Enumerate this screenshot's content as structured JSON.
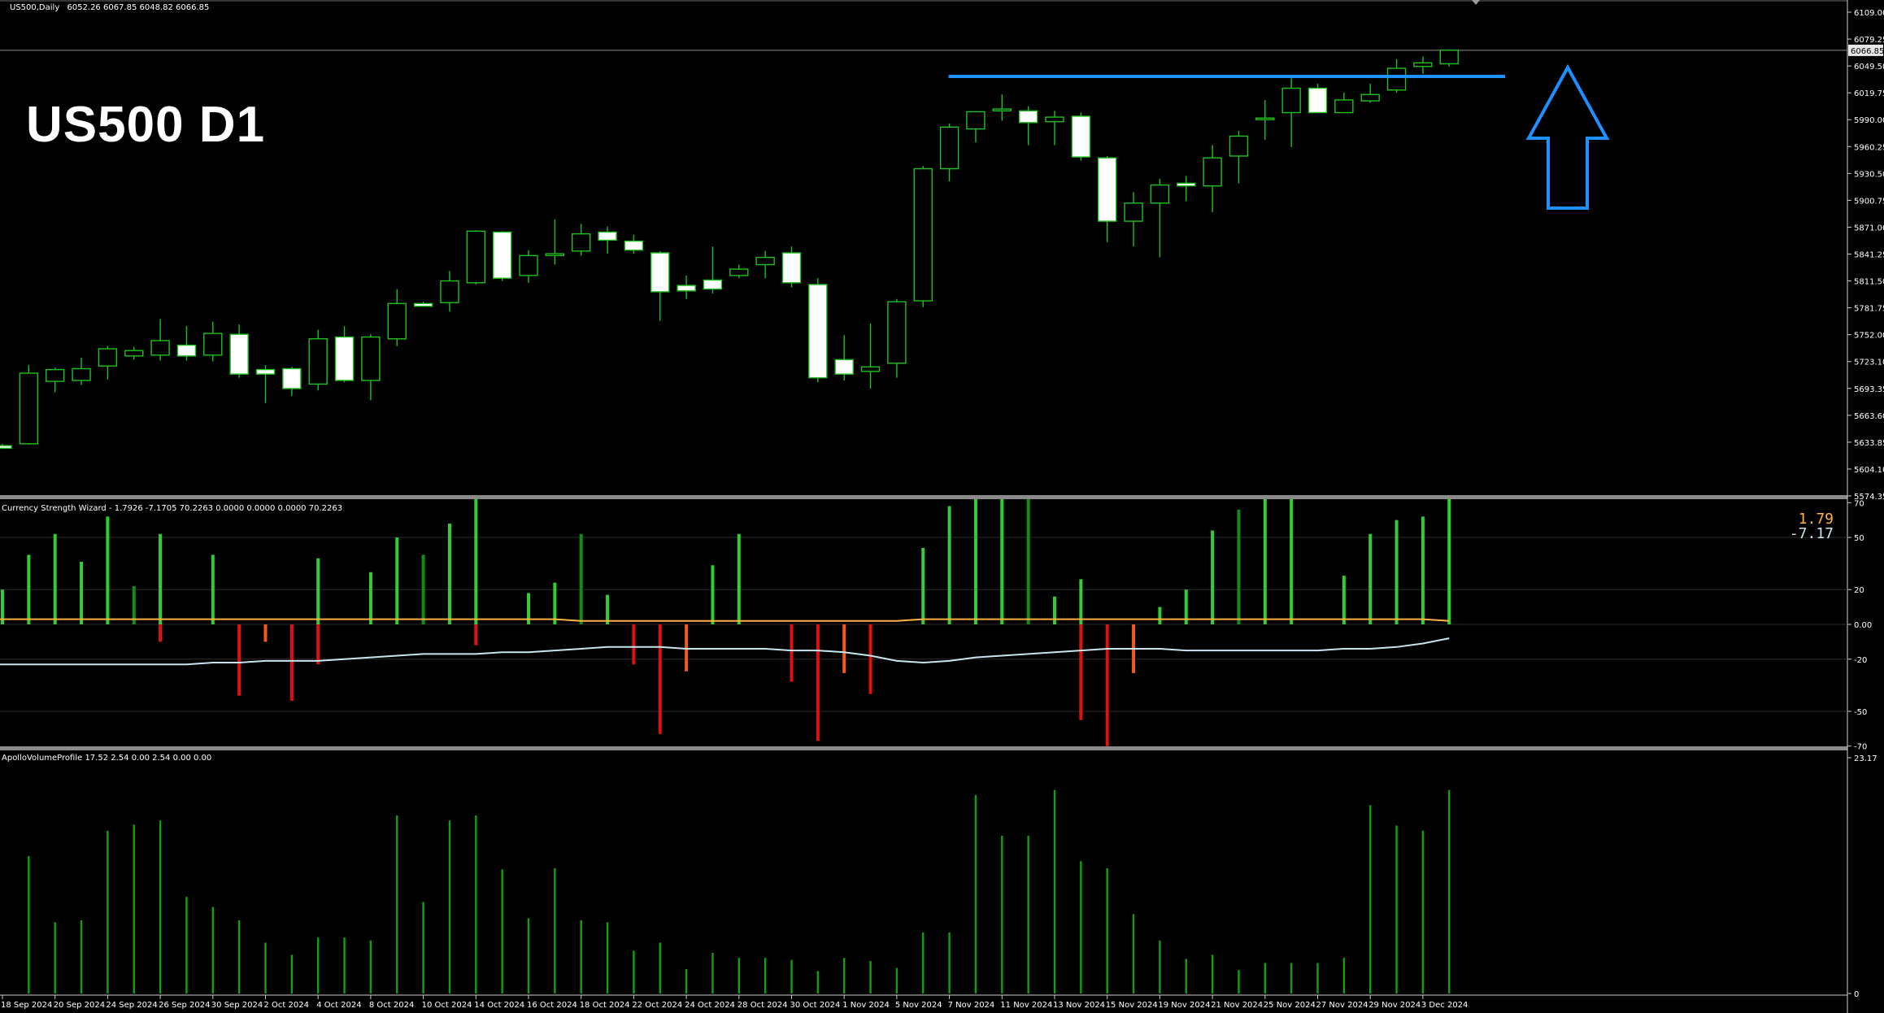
{
  "header": {
    "symbol_label": "US500,Daily",
    "ohlc": "6052.26 6067.85 6048.82 6066.85",
    "big_label": "US500 D1",
    "csw_label": "Currency Strength Wizard - 1.7926 -7.1705 70.2263 0.0000 0.0000 0.0000 70.2263",
    "avp_label": "ApolloVolumeProfile 17.52 2.54 0.00 2.54 0.00 0.00",
    "csw_value_1": "1.79",
    "csw_value_2": "-7.17"
  },
  "colors": {
    "background": "#000000",
    "grid": "#2d2d2d",
    "candle_wick": "#1fc01f",
    "candle_bull_body": "#000000",
    "candle_bear_body": "#ffffff",
    "resistance_line": "#1e90ff",
    "arrow": "#1e90ff",
    "pos_bar": "#33cc33",
    "pos_bar_dark": "#168a16",
    "neg_bar": "#e01010",
    "neg_bar_orange": "#f05a1e",
    "csw_line_1": "#ffb347",
    "csw_line_2": "#c8e6f0",
    "volume_bar": "#129f12",
    "csw_value_1": "#ffb347",
    "csw_value_2": "#c8e6f0"
  },
  "chart_data": [
    {
      "type": "candlestick",
      "name": "price",
      "ylim": [
        5574.35,
        6109.0
      ],
      "y_ticks": [
        "6109.00",
        "6079.25",
        "6049.50",
        "6019.75",
        "5990.00",
        "5960.25",
        "5930.50",
        "5900.75",
        "5871.00",
        "5841.25",
        "5811.50",
        "5781.75",
        "5752.00",
        "5723.10",
        "5693.35",
        "5663.60",
        "5633.85",
        "5604.10",
        "5574.35"
      ],
      "current_price": "6066.85",
      "current_price_value": 6066.85,
      "resistance_level": 6038.0,
      "resistance_range": [
        36,
        57
      ],
      "arrow": "up",
      "x_tick_labels": [
        {
          "i": 0,
          "label": "18 Sep 2024"
        },
        {
          "i": 2,
          "label": "20 Sep 2024"
        },
        {
          "i": 4,
          "label": "24 Sep 2024"
        },
        {
          "i": 6,
          "label": "26 Sep 2024"
        },
        {
          "i": 8,
          "label": "30 Sep 2024"
        },
        {
          "i": 10,
          "label": "2 Oct 2024"
        },
        {
          "i": 12,
          "label": "4 Oct 2024"
        },
        {
          "i": 14,
          "label": "8 Oct 2024"
        },
        {
          "i": 16,
          "label": "10 Oct 2024"
        },
        {
          "i": 18,
          "label": "14 Oct 2024"
        },
        {
          "i": 20,
          "label": "16 Oct 2024"
        },
        {
          "i": 22,
          "label": "18 Oct 2024"
        },
        {
          "i": 24,
          "label": "22 Oct 2024"
        },
        {
          "i": 26,
          "label": "24 Oct 2024"
        },
        {
          "i": 28,
          "label": "28 Oct 2024"
        },
        {
          "i": 30,
          "label": "30 Oct 2024"
        },
        {
          "i": 32,
          "label": "1 Nov 2024"
        },
        {
          "i": 34,
          "label": "5 Nov 2024"
        },
        {
          "i": 36,
          "label": "7 Nov 2024"
        },
        {
          "i": 38,
          "label": "11 Nov 2024"
        },
        {
          "i": 40,
          "label": "13 Nov 2024"
        },
        {
          "i": 42,
          "label": "15 Nov 2024"
        },
        {
          "i": 44,
          "label": "19 Nov 2024"
        },
        {
          "i": 46,
          "label": "21 Nov 2024"
        },
        {
          "i": 48,
          "label": "25 Nov 2024"
        },
        {
          "i": 50,
          "label": "27 Nov 2024"
        },
        {
          "i": 52,
          "label": "29 Nov 2024"
        },
        {
          "i": 54,
          "label": "3 Dec 2024"
        }
      ],
      "candles": [
        {
          "o": 5630,
          "h": 5632,
          "l": 5627,
          "c": 5627
        },
        {
          "o": 5632,
          "h": 5719,
          "l": 5631,
          "c": 5710
        },
        {
          "o": 5701,
          "h": 5716,
          "l": 5689,
          "c": 5714
        },
        {
          "o": 5702,
          "h": 5727,
          "l": 5697,
          "c": 5715
        },
        {
          "o": 5718,
          "h": 5740,
          "l": 5703,
          "c": 5737
        },
        {
          "o": 5729,
          "h": 5739,
          "l": 5725,
          "c": 5735
        },
        {
          "o": 5730,
          "h": 5770,
          "l": 5724,
          "c": 5746
        },
        {
          "o": 5741,
          "h": 5762,
          "l": 5724,
          "c": 5729
        },
        {
          "o": 5730,
          "h": 5767,
          "l": 5723,
          "c": 5754
        },
        {
          "o": 5753,
          "h": 5764,
          "l": 5705,
          "c": 5709
        },
        {
          "o": 5714,
          "h": 5719,
          "l": 5677,
          "c": 5709
        },
        {
          "o": 5715,
          "h": 5717,
          "l": 5685,
          "c": 5693
        },
        {
          "o": 5698,
          "h": 5758,
          "l": 5691,
          "c": 5748
        },
        {
          "o": 5750,
          "h": 5762,
          "l": 5700,
          "c": 5702
        },
        {
          "o": 5702,
          "h": 5753,
          "l": 5680,
          "c": 5750
        },
        {
          "o": 5748,
          "h": 5803,
          "l": 5740,
          "c": 5787
        },
        {
          "o": 5787,
          "h": 5789,
          "l": 5784,
          "c": 5784
        },
        {
          "o": 5788,
          "h": 5823,
          "l": 5778,
          "c": 5812
        },
        {
          "o": 5810,
          "h": 5868,
          "l": 5808,
          "c": 5867
        },
        {
          "o": 5866,
          "h": 5867,
          "l": 5812,
          "c": 5815
        },
        {
          "o": 5818,
          "h": 5846,
          "l": 5810,
          "c": 5840
        },
        {
          "o": 5840,
          "h": 5880,
          "l": 5830,
          "c": 5842
        },
        {
          "o": 5845,
          "h": 5875,
          "l": 5840,
          "c": 5864
        },
        {
          "o": 5866,
          "h": 5872,
          "l": 5842,
          "c": 5857
        },
        {
          "o": 5856,
          "h": 5863,
          "l": 5842,
          "c": 5846
        },
        {
          "o": 5843,
          "h": 5845,
          "l": 5768,
          "c": 5800
        },
        {
          "o": 5807,
          "h": 5818,
          "l": 5792,
          "c": 5801
        },
        {
          "o": 5813,
          "h": 5850,
          "l": 5798,
          "c": 5803
        },
        {
          "o": 5818,
          "h": 5830,
          "l": 5815,
          "c": 5825
        },
        {
          "o": 5830,
          "h": 5845,
          "l": 5815,
          "c": 5838
        },
        {
          "o": 5843,
          "h": 5850,
          "l": 5805,
          "c": 5810
        },
        {
          "o": 5808,
          "h": 5815,
          "l": 5700,
          "c": 5705
        },
        {
          "o": 5725,
          "h": 5752,
          "l": 5702,
          "c": 5709
        },
        {
          "o": 5712,
          "h": 5765,
          "l": 5693,
          "c": 5717
        },
        {
          "o": 5721,
          "h": 5792,
          "l": 5705,
          "c": 5789
        },
        {
          "o": 5790,
          "h": 5939,
          "l": 5783,
          "c": 5936
        },
        {
          "o": 5936,
          "h": 5986,
          "l": 5922,
          "c": 5982
        },
        {
          "o": 5980,
          "h": 5998,
          "l": 5965,
          "c": 5999
        },
        {
          "o": 6000,
          "h": 6018,
          "l": 5989,
          "c": 6002
        },
        {
          "o": 6000,
          "h": 6005,
          "l": 5962,
          "c": 5987
        },
        {
          "o": 5988,
          "h": 6000,
          "l": 5962,
          "c": 5993
        },
        {
          "o": 5994,
          "h": 5998,
          "l": 5945,
          "c": 5949
        },
        {
          "o": 5948,
          "h": 5950,
          "l": 5855,
          "c": 5878
        },
        {
          "o": 5878,
          "h": 5910,
          "l": 5850,
          "c": 5898
        },
        {
          "o": 5898,
          "h": 5925,
          "l": 5838,
          "c": 5918
        },
        {
          "o": 5920,
          "h": 5928,
          "l": 5900,
          "c": 5917
        },
        {
          "o": 5917,
          "h": 5962,
          "l": 5888,
          "c": 5948
        },
        {
          "o": 5950,
          "h": 5978,
          "l": 5920,
          "c": 5972
        },
        {
          "o": 5992,
          "h": 6012,
          "l": 5968,
          "c": 5992
        },
        {
          "o": 5998,
          "h": 6036,
          "l": 5960,
          "c": 6025
        },
        {
          "o": 6025,
          "h": 6030,
          "l": 5998,
          "c": 5998
        },
        {
          "o": 5998,
          "h": 6020,
          "l": 5998,
          "c": 6012
        },
        {
          "o": 6011,
          "h": 6030,
          "l": 6009,
          "c": 6018
        },
        {
          "o": 6023,
          "h": 6057,
          "l": 6020,
          "c": 6047
        },
        {
          "o": 6049,
          "h": 6060,
          "l": 6041,
          "c": 6053
        },
        {
          "o": 6052,
          "h": 6068,
          "l": 6049,
          "c": 6067
        }
      ]
    },
    {
      "type": "bar",
      "name": "Currency Strength Wizard",
      "ylim": [
        -72,
        72
      ],
      "y_ticks": [
        "70",
        "50",
        "20",
        "0.00",
        "-20",
        "-50",
        "-70"
      ],
      "pos_values": [
        20,
        40,
        52,
        36,
        62,
        22,
        52,
        0,
        40,
        0,
        0,
        0,
        38,
        0,
        30,
        50,
        40,
        58,
        72,
        0,
        18,
        24,
        52,
        17,
        0,
        0,
        0,
        34,
        52,
        0,
        0,
        0,
        0,
        0,
        0,
        44,
        68,
        72,
        72,
        72,
        16,
        26,
        0,
        0,
        10,
        20,
        54,
        66,
        72,
        72,
        0,
        28,
        52,
        60,
        62,
        72
      ],
      "pos_dark": [
        5,
        16,
        22,
        39,
        47
      ],
      "neg_values": [
        0,
        0,
        0,
        0,
        0,
        0,
        -10,
        0,
        0,
        -41,
        -10,
        -44,
        -23,
        0,
        0,
        0,
        0,
        0,
        -12,
        0,
        0,
        0,
        0,
        0,
        -23,
        -63,
        -27,
        0,
        0,
        0,
        -33,
        -67,
        -28,
        -40,
        0,
        0,
        0,
        0,
        0,
        0,
        0,
        -55,
        -70,
        -28,
        0,
        0,
        0,
        0,
        0,
        0,
        0,
        0,
        0,
        0,
        0,
        0
      ],
      "neg_orange": [
        10,
        26,
        32,
        43
      ],
      "line_1": [
        3,
        3,
        3,
        3,
        3,
        3,
        3,
        3,
        3,
        3,
        3,
        3,
        3,
        3,
        3,
        3,
        3,
        3,
        3,
        3,
        3,
        3,
        2,
        2,
        2,
        2,
        2,
        2,
        2,
        2,
        2,
        2,
        2,
        2,
        2,
        3,
        3,
        3,
        3,
        3,
        3,
        3,
        3,
        3,
        3,
        3,
        3,
        3,
        3,
        3,
        3,
        3,
        3,
        3,
        3,
        2
      ],
      "line_2": [
        -23,
        -23,
        -23,
        -23,
        -23,
        -23,
        -23,
        -23,
        -22,
        -22,
        -21,
        -21,
        -21,
        -20,
        -19,
        -18,
        -17,
        -17,
        -17,
        -16,
        -16,
        -15,
        -14,
        -13,
        -13,
        -13,
        -14,
        -14,
        -14,
        -14,
        -15,
        -15,
        -16,
        -18,
        -21,
        -22,
        -21,
        -19,
        -18,
        -17,
        -16,
        -15,
        -14,
        -14,
        -14,
        -15,
        -15,
        -15,
        -15,
        -15,
        -15,
        -14,
        -14,
        -13,
        -11,
        -8
      ]
    },
    {
      "type": "bar",
      "name": "ApolloVolumeProfile",
      "ylim": [
        0,
        23.17
      ],
      "y_ticks": [
        "23.17",
        "0"
      ],
      "values": [
        13.5,
        7.0,
        7.2,
        16.0,
        16.6,
        17.0,
        9.5,
        8.5,
        7.2,
        5.0,
        3.8,
        5.5,
        5.5,
        5.2,
        17.5,
        9.0,
        17.0,
        17.5,
        12.2,
        7.4,
        12.3,
        7.2,
        7.0,
        4.2,
        5.0,
        2.4,
        4.0,
        3.5,
        3.5,
        3.3,
        2.2,
        3.5,
        3.2,
        2.5,
        6.0,
        6.0,
        19.5,
        15.5,
        15.5,
        20.0,
        13.0,
        12.3,
        7.8,
        5.2,
        3.4,
        3.8,
        2.3,
        3.0,
        3.0,
        3.0,
        3.5,
        18.5,
        16.5,
        16.0,
        20.0
      ]
    }
  ]
}
